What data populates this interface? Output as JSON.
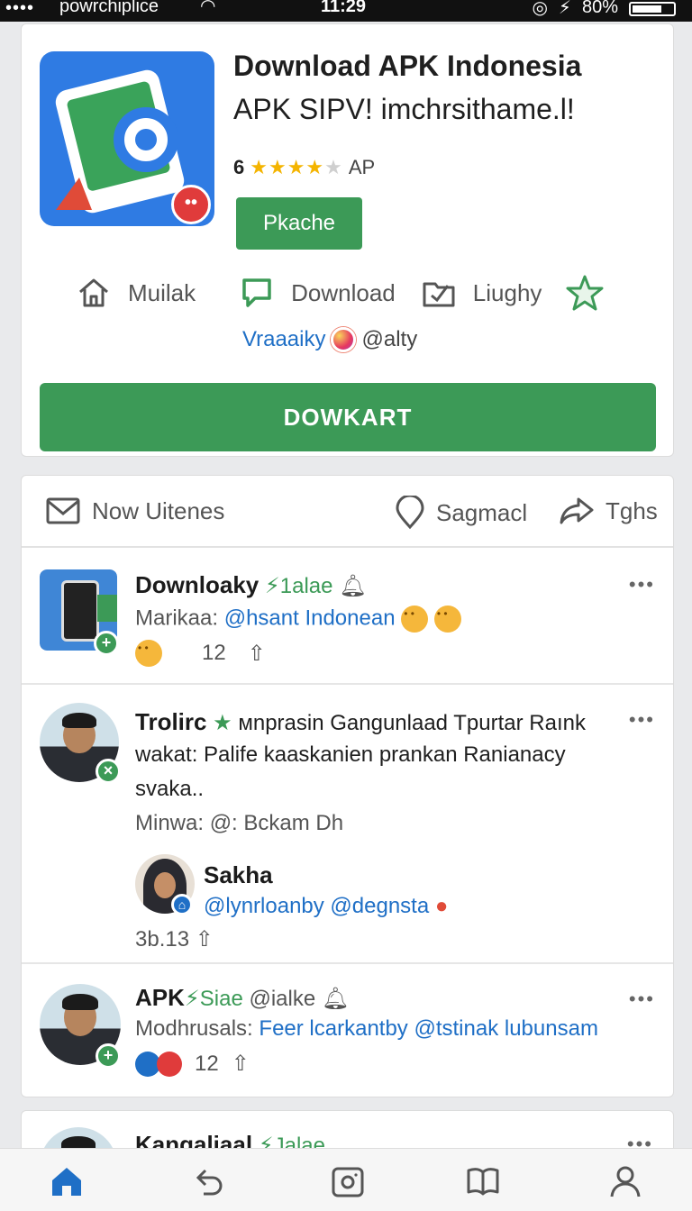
{
  "status_bar": {
    "signal": "••••",
    "carrier": "powrchiplice",
    "time": "11:29",
    "battery": "80%"
  },
  "app": {
    "title": "Download APK Indonesia",
    "subtitle": "APK SIPV! imchrsithame.l!",
    "rating_count": "6",
    "rating_stars": 4,
    "rating_suffix": "AP",
    "package_button": "Pkache",
    "actions": [
      {
        "label": "Muilak",
        "icon": "home-icon"
      },
      {
        "label": "Download",
        "icon": "comment-icon"
      },
      {
        "label": "Liughy",
        "icon": "folder-check-icon"
      }
    ],
    "favorite_icon": "star-outline-icon",
    "social_name": "Vraaaiky",
    "social_handle": "@alty",
    "main_button": "DOWKART"
  },
  "feed": {
    "tabs": [
      {
        "label": "Now Uitenes",
        "icon": "mail-icon"
      },
      {
        "label": "Sagmacl",
        "icon": "location-pin-icon"
      },
      {
        "label": "Tghs",
        "icon": "share-icon"
      }
    ],
    "posts": [
      {
        "name": "Downloaky",
        "tag": "1alae",
        "line1_label": "Marikaa:",
        "line1_link": "@hsant Indonean",
        "count": "12",
        "more": "•••"
      },
      {
        "name": "Trolirc",
        "text1": "мnprasin Gangunlaad Tpurtar Raınk",
        "text2": "wakat: Palife kaaskanien prankan Ranianacy",
        "text3": "svaka..",
        "meta": "Minwa: @: Bckam",
        "meta_suffix": "Dh",
        "more": "•••",
        "reply": {
          "name": "Sakha",
          "handles": "@lynrloanby @degnsta",
          "count": "3b.13"
        }
      },
      {
        "name": "APK",
        "tag": "Siae",
        "handle": "@ialke",
        "line1_label": "Modhrusals:",
        "line1_link": "Feer lcarkantby @tstinak lubunsam",
        "count": "12",
        "more": "•••"
      },
      {
        "name": "Kangaliaal",
        "tag": "Jalae",
        "more": "•••"
      }
    ]
  },
  "bottom_nav": [
    {
      "name": "home",
      "icon": "home-icon"
    },
    {
      "name": "back",
      "icon": "undo-icon"
    },
    {
      "name": "camera",
      "icon": "camera-icon"
    },
    {
      "name": "book",
      "icon": "book-icon"
    },
    {
      "name": "profile",
      "icon": "person-icon"
    }
  ],
  "colors": {
    "accent_green": "#3c9a57",
    "link_blue": "#1f6fc6",
    "star_gold": "#f4b400",
    "nav_active": "#1f6fc6"
  }
}
